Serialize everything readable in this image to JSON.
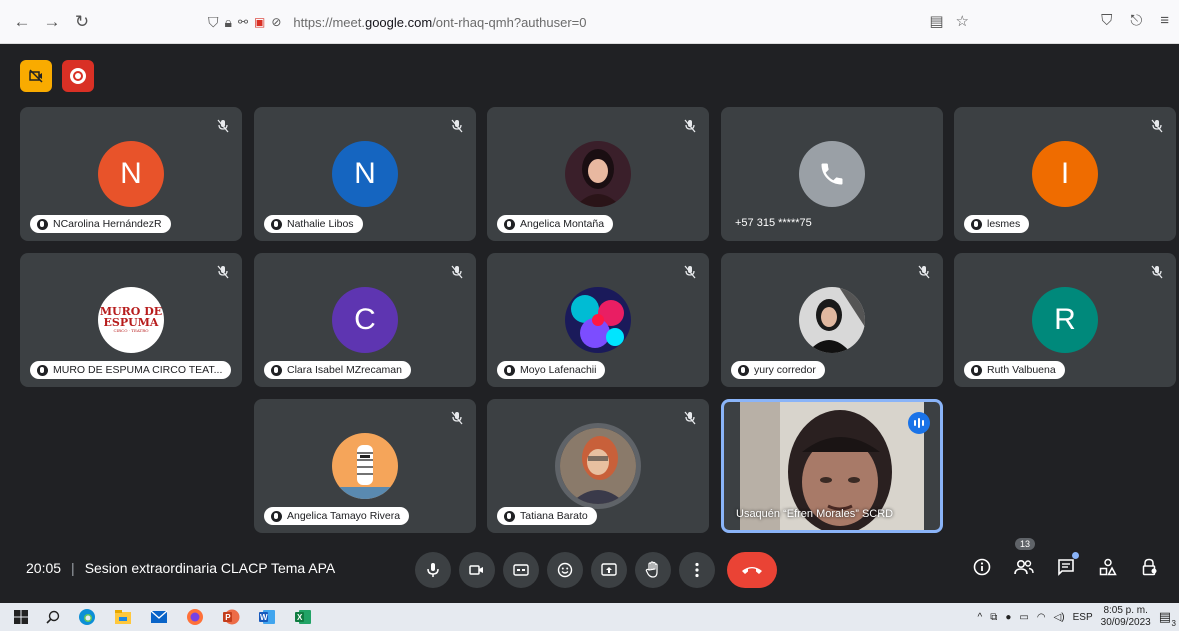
{
  "browser": {
    "url_prefix": "https://meet.",
    "url_domain": "google.com",
    "url_path": "/ont-rhaq-qmh?authuser=0"
  },
  "participants": [
    {
      "name": "NCarolina HernándezR",
      "initial": "N",
      "color": "#e8532a"
    },
    {
      "name": "Nathalie Libos",
      "initial": "N",
      "color": "#1565c0"
    },
    {
      "name": "Angelica Montaña",
      "initial": "",
      "color": "#4a2a2a"
    },
    {
      "name": "+57 315 *****75",
      "initial": "",
      "color": "#9aa0a6"
    },
    {
      "name": "lesmes",
      "initial": "I",
      "color": "#ef6c00"
    },
    {
      "name": "MURO DE ESPUMA CIRCO TEAT...",
      "initial": "",
      "color": "#ffffff",
      "logo_line1": "MURO DE",
      "logo_line2": "ESPUMA",
      "logo_line3": "CIRCO · TEATRO"
    },
    {
      "name": "Clara Isabel MZrecaman",
      "initial": "C",
      "color": "#5e35b1"
    },
    {
      "name": "Moyo Lafenachii",
      "initial": "",
      "color": "#3a2a6a"
    },
    {
      "name": "yury corredor",
      "initial": "",
      "color": "#2d2d2d"
    },
    {
      "name": "Ruth Valbuena",
      "initial": "R",
      "color": "#00897b"
    },
    {
      "name": "Angelica Tamayo Rivera",
      "initial": "",
      "color": "#f0a04b"
    },
    {
      "name": "Tatiana Barato",
      "initial": "",
      "color": "#6a5a4a"
    },
    {
      "name": "Usaquén “Efren Morales” SCRD",
      "initial": "",
      "color": "#7a6a60"
    }
  ],
  "meeting": {
    "time": "20:05",
    "separator": "|",
    "title": "Sesion extraordinaria CLACP Tema APA",
    "people_count": "13"
  },
  "taskbar": {
    "language": "ESP",
    "time": "8:05 p. m.",
    "date": "30/09/2023",
    "notif_count": "3"
  },
  "colors": {
    "meet_bg": "#202124",
    "tile_bg": "#3c4043",
    "end_call": "#ea4335",
    "active_speaker": "#8ab4f8"
  }
}
